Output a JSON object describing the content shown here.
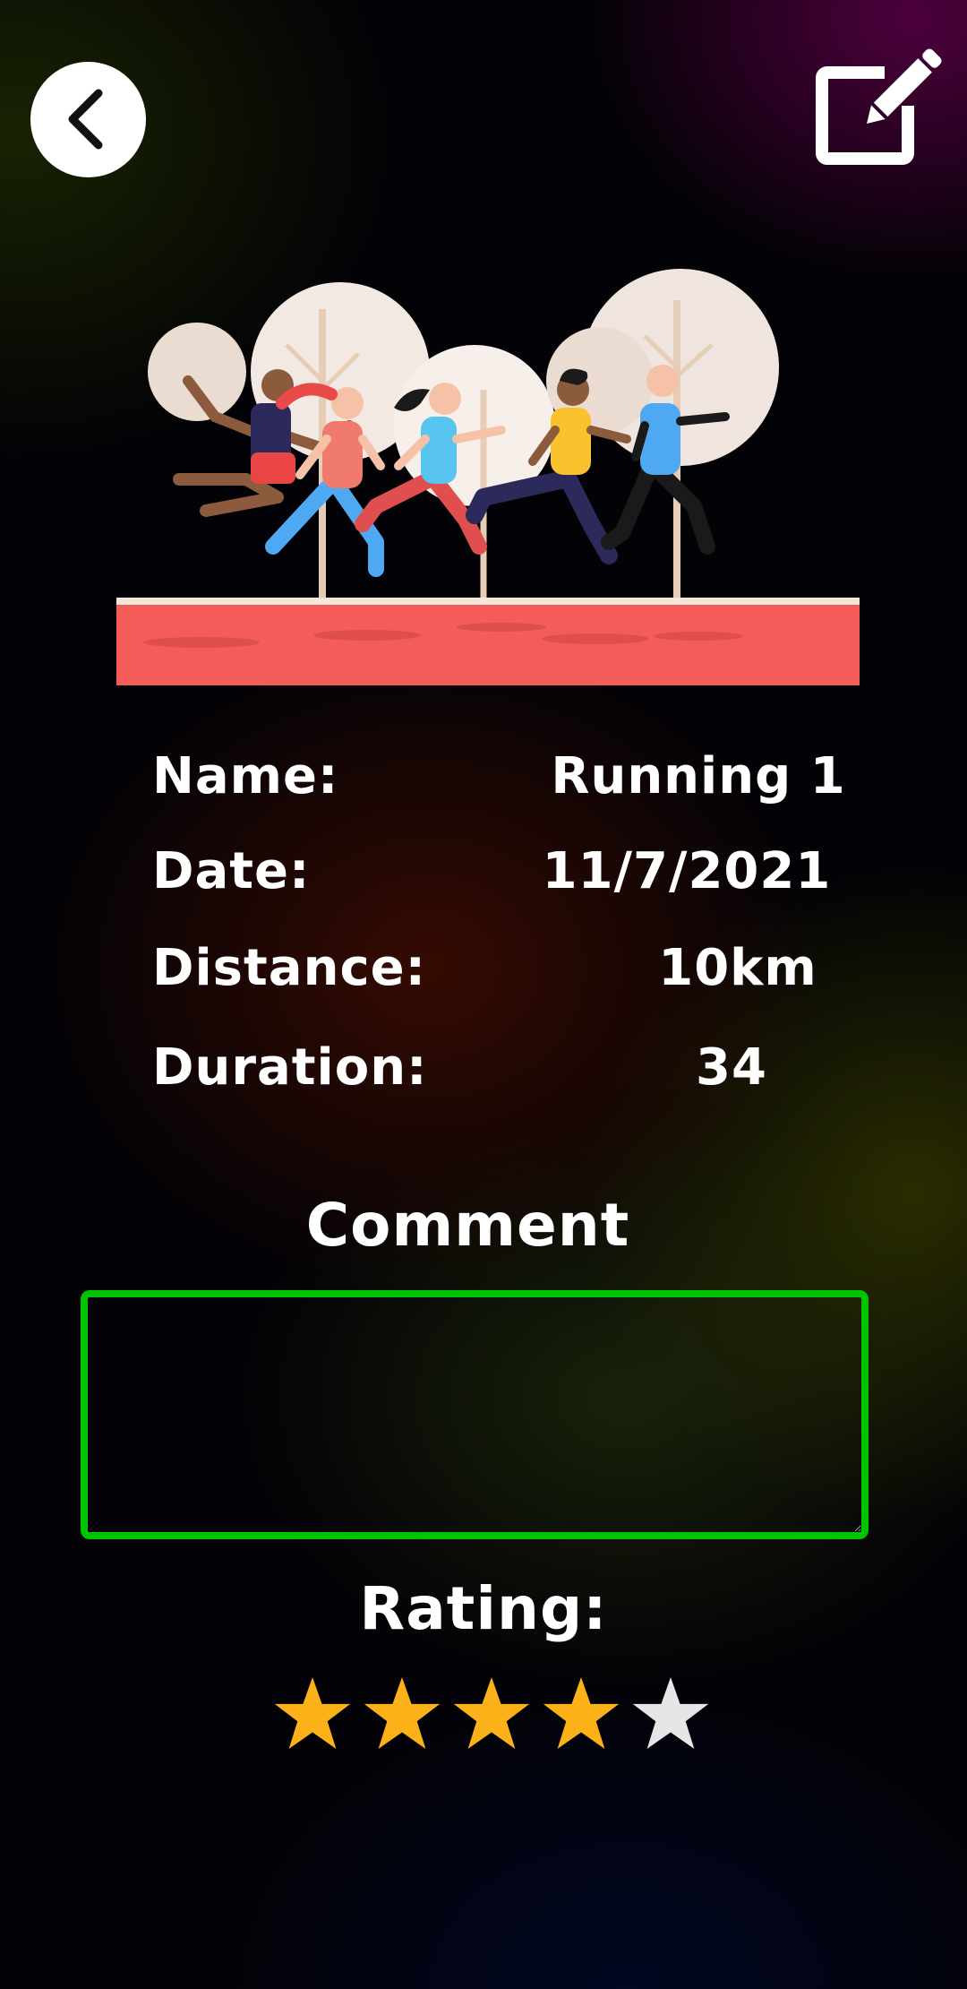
{
  "nav": {
    "back_icon": "chevron-left-icon",
    "edit_icon": "edit-pencil-icon"
  },
  "details": {
    "name_label": "Name:",
    "name_value": "Running 1",
    "date_label": "Date:",
    "date_value": "11/7/2021",
    "distance_label": "Distance:",
    "distance_value": "10km",
    "duration_label": "Duration:",
    "duration_value": "34"
  },
  "comment": {
    "title": "Comment",
    "value": ""
  },
  "rating": {
    "title": "Rating:",
    "value": 4,
    "max": 5,
    "filled_color": "#FBB117",
    "empty_color": "#E6E6E6"
  },
  "colors": {
    "comment_border": "#00C400",
    "track": "#F45C5A"
  }
}
